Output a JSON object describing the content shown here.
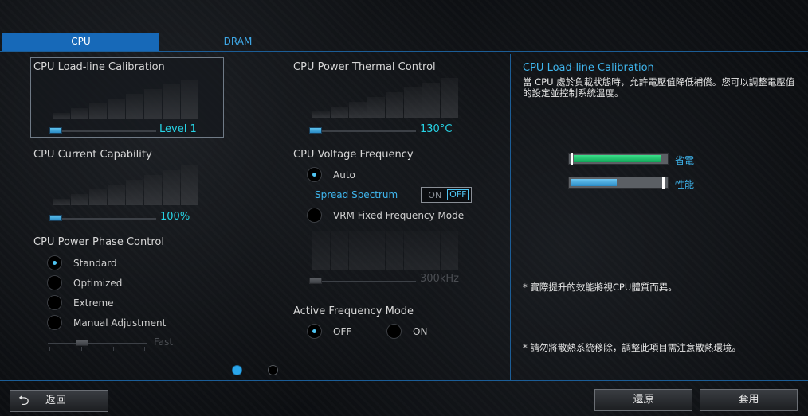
{
  "tabs": [
    {
      "label": "CPU",
      "active": true
    },
    {
      "label": "DRAM",
      "active": false
    }
  ],
  "load_line": {
    "label": "CPU Load-line Calibration",
    "value": "Level 1"
  },
  "current_capability": {
    "label": "CPU Current Capability",
    "value": "100%"
  },
  "phase_control": {
    "label": "CPU Power Phase Control",
    "options": [
      "Standard",
      "Optimized",
      "Extreme",
      "Manual Adjustment"
    ],
    "selected": "Standard",
    "slider_value": "Fast"
  },
  "thermal_control": {
    "label": "CPU Power Thermal Control",
    "value": "130°C"
  },
  "voltage_frequency": {
    "label": "CPU Voltage Frequency",
    "auto_label": "Auto",
    "spread_spectrum_label": "Spread Spectrum",
    "toggle_off": "ON",
    "toggle_on": "OFF",
    "vrm_label": "VRM Fixed Frequency Mode",
    "vrm_value": "300kHz"
  },
  "active_frequency": {
    "label": "Active Frequency Mode",
    "off_label": "OFF",
    "on_label": "ON",
    "selected": "OFF"
  },
  "help": {
    "title": "CPU Load-line Calibration",
    "description": "當 CPU 處於負載狀態時，允許電壓值降低補償。您可以調整電壓值的設定並控制系統溫度。",
    "meter_saving_label": "省電",
    "meter_saving_level": 0.95,
    "meter_perf_label": "性能",
    "meter_perf_level": 0.5,
    "note1": "* 實際提升的效能將視CPU體質而異。",
    "note2": "* 請勿將散熱系統移除，調整此項目需注意散熱環境。"
  },
  "pagination": {
    "pages": 2,
    "current": 1
  },
  "footer": {
    "back_label": "返回",
    "reset_label": "還原",
    "apply_label": "套用"
  },
  "colors": {
    "accent": "#1769b8",
    "value_text": "#27d4e6",
    "meter_green": "#1ec46a",
    "meter_blue": "#3aa6e0"
  }
}
